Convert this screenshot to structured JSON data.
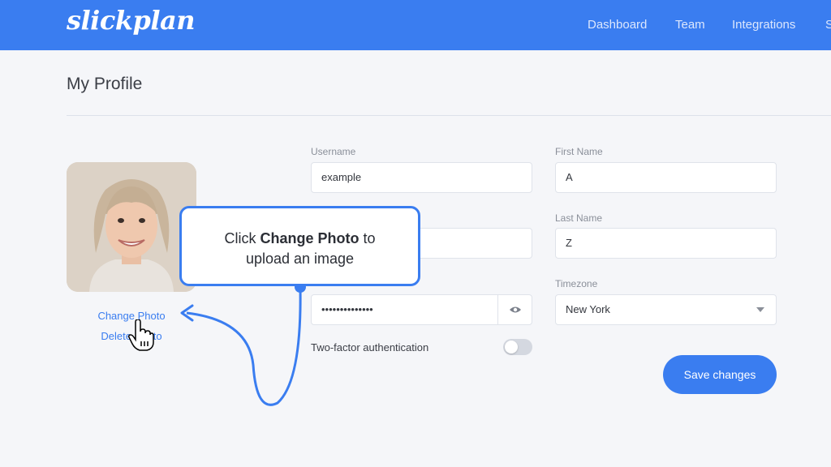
{
  "header": {
    "logo": "slickplan",
    "nav": [
      "Dashboard",
      "Team",
      "Integrations",
      "S"
    ]
  },
  "page": {
    "title": "My Profile"
  },
  "photo": {
    "change_label": "Change Photo",
    "delete_label": "Delete Photo"
  },
  "form": {
    "username": {
      "label": "Username",
      "value": "example"
    },
    "email": {
      "value": ""
    },
    "password": {
      "value": "••••••••••••••"
    },
    "two_factor": {
      "label": "Two-factor authentication",
      "enabled": false
    },
    "first_name": {
      "label": "First Name",
      "value": "A"
    },
    "last_name": {
      "label": "Last Name",
      "value": "Z"
    },
    "timezone": {
      "label": "Timezone",
      "value": "New York"
    },
    "save_label": "Save changes"
  },
  "tutorial": {
    "prefix": "Click ",
    "highlight": "Change Photo",
    "suffix": " to",
    "line2": "upload an image"
  },
  "colors": {
    "accent": "#3a7df0",
    "background": "#f5f6f9"
  },
  "icons": [
    "eye-icon",
    "dropdown-caret-icon",
    "pointer-hand-icon",
    "arrow-icon"
  ]
}
